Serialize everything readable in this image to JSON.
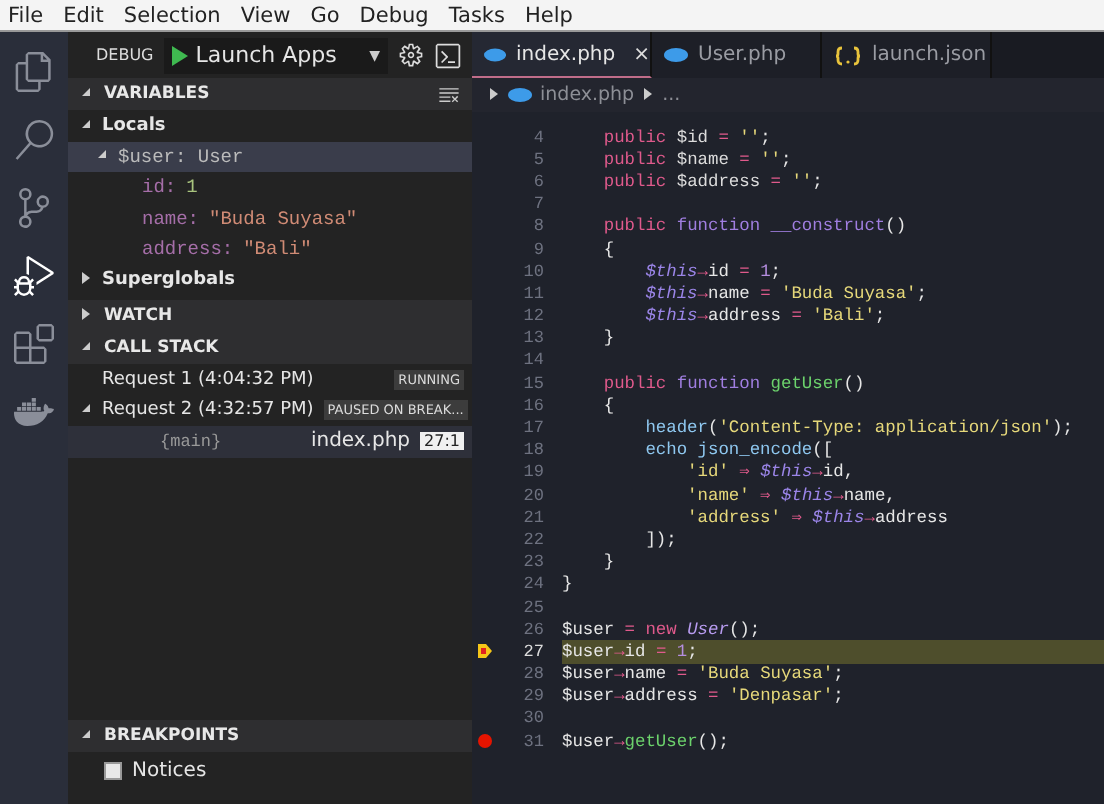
{
  "menu": [
    "File",
    "Edit",
    "Selection",
    "View",
    "Go",
    "Debug",
    "Tasks",
    "Help"
  ],
  "activity": [
    {
      "kind": "files",
      "selected": false
    },
    {
      "kind": "search",
      "selected": false
    },
    {
      "kind": "git",
      "selected": false
    },
    {
      "kind": "debug",
      "selected": true
    },
    {
      "kind": "extensions",
      "selected": false
    },
    {
      "kind": "docker",
      "selected": false
    }
  ],
  "debug_toolbar": {
    "label": "DEBUG",
    "config": "Launch Apps",
    "caret": "▼"
  },
  "sidebar": {
    "variables": {
      "title": "VARIABLES",
      "expanded": true,
      "scopes": [
        {
          "label": "Locals",
          "expanded": true,
          "children": [
            {
              "label": "$user: User",
              "expanded": true,
              "selected": true,
              "children": [
                {
                  "key": "id:",
                  "value": "1",
                  "kind": "number"
                },
                {
                  "key": "name:",
                  "value": "\"Buda Suyasa\"",
                  "kind": "string"
                },
                {
                  "key": "address:",
                  "value": "\"Bali\"",
                  "kind": "string"
                }
              ]
            }
          ]
        },
        {
          "label": "Superglobals",
          "expanded": false
        }
      ]
    },
    "watch": {
      "title": "WATCH",
      "expanded": false
    },
    "call_stack": {
      "title": "CALL STACK",
      "expanded": true,
      "requests": [
        {
          "label": "Request 1 (4:04:32 PM)",
          "status": "RUNNING",
          "expanded": false
        },
        {
          "label": "Request 2 (4:32:57 PM)",
          "status": "PAUSED ON BREAK...",
          "expanded": true,
          "frames": [
            {
              "name": "{main}",
              "file": "index.php",
              "position": "27:1"
            }
          ]
        }
      ]
    },
    "breakpoints": {
      "title": "BREAKPOINTS",
      "expanded": true,
      "items": [
        {
          "label": "Notices",
          "checked": false
        }
      ]
    }
  },
  "tabs": [
    {
      "label": "index.php",
      "kind": "php",
      "selected": true,
      "close": "×"
    },
    {
      "label": "User.php",
      "kind": "php",
      "selected": false
    },
    {
      "label": "launch.json",
      "kind": "json",
      "selected": false
    }
  ],
  "breadcrumb": {
    "file": "index.php",
    "rest": "..."
  },
  "code": [
    {
      "n": "4",
      "tokens": [
        {
          "kind": "keyword",
          "text": "    public"
        },
        {
          "kind": "variable",
          "text": " $id"
        },
        {
          "kind": "operator",
          "text": " = "
        },
        {
          "kind": "string",
          "text": "''"
        },
        {
          "kind": "plain",
          "text": ";"
        }
      ]
    },
    {
      "n": "5",
      "tokens": [
        {
          "kind": "keyword",
          "text": "    public"
        },
        {
          "kind": "variable",
          "text": " $name"
        },
        {
          "kind": "operator",
          "text": " = "
        },
        {
          "kind": "string",
          "text": "''"
        },
        {
          "kind": "plain",
          "text": ";"
        }
      ]
    },
    {
      "n": "6",
      "tokens": [
        {
          "kind": "keyword",
          "text": "    public"
        },
        {
          "kind": "variable",
          "text": " $address"
        },
        {
          "kind": "operator",
          "text": " = "
        },
        {
          "kind": "string",
          "text": "''"
        },
        {
          "kind": "plain",
          "text": ";"
        }
      ]
    },
    {
      "n": "7"
    },
    {
      "n": "8",
      "tokens": [
        {
          "kind": "keyword",
          "text": "    public"
        },
        {
          "kind": "function",
          "text": " function"
        },
        {
          "kind": "definition",
          "text": " __construct"
        },
        {
          "kind": "plain",
          "text": "()"
        }
      ]
    },
    {
      "n": "9",
      "tokens": [
        {
          "kind": "plain",
          "text": "    {"
        }
      ]
    },
    {
      "n": "10",
      "tokens": [
        {
          "kind": "this",
          "text": "        $this"
        },
        {
          "kind": "operator",
          "text": "→"
        },
        {
          "kind": "plain",
          "text": "id"
        },
        {
          "kind": "operator",
          "text": " = "
        },
        {
          "kind": "number",
          "text": "1"
        },
        {
          "kind": "plain",
          "text": ";"
        }
      ]
    },
    {
      "n": "11",
      "tokens": [
        {
          "kind": "this",
          "text": "        $this"
        },
        {
          "kind": "operator",
          "text": "→"
        },
        {
          "kind": "plain",
          "text": "name"
        },
        {
          "kind": "operator",
          "text": " = "
        },
        {
          "kind": "string",
          "text": "'Buda Suyasa'"
        },
        {
          "kind": "plain",
          "text": ";"
        }
      ]
    },
    {
      "n": "12",
      "tokens": [
        {
          "kind": "this",
          "text": "        $this"
        },
        {
          "kind": "operator",
          "text": "→"
        },
        {
          "kind": "plain",
          "text": "address"
        },
        {
          "kind": "operator",
          "text": " = "
        },
        {
          "kind": "string",
          "text": "'Bali'"
        },
        {
          "kind": "plain",
          "text": ";"
        }
      ]
    },
    {
      "n": "13",
      "tokens": [
        {
          "kind": "plain",
          "text": "    }"
        }
      ]
    },
    {
      "n": "14"
    },
    {
      "n": "15",
      "tokens": [
        {
          "kind": "keyword",
          "text": "    public"
        },
        {
          "kind": "function",
          "text": " function"
        },
        {
          "kind": "call",
          "text": " getUser"
        },
        {
          "kind": "plain",
          "text": "()"
        }
      ]
    },
    {
      "n": "16",
      "tokens": [
        {
          "kind": "plain",
          "text": "    {"
        }
      ]
    },
    {
      "n": "17",
      "tokens": [
        {
          "kind": "builtin",
          "text": "        header"
        },
        {
          "kind": "plain",
          "text": "("
        },
        {
          "kind": "string",
          "text": "'Content-Type: application/json'"
        },
        {
          "kind": "plain",
          "text": ");"
        }
      ]
    },
    {
      "n": "18",
      "tokens": [
        {
          "kind": "builtin",
          "text": "        echo json_encode"
        },
        {
          "kind": "plain",
          "text": "(["
        }
      ]
    },
    {
      "n": "19",
      "tokens": [
        {
          "kind": "string",
          "text": "            'id'"
        },
        {
          "kind": "operator",
          "text": " ⇒ "
        },
        {
          "kind": "this",
          "text": "$this"
        },
        {
          "kind": "operator",
          "text": "→"
        },
        {
          "kind": "plain",
          "text": "id,"
        }
      ]
    },
    {
      "n": "20",
      "tokens": [
        {
          "kind": "string",
          "text": "            'name'"
        },
        {
          "kind": "operator",
          "text": " ⇒ "
        },
        {
          "kind": "this",
          "text": "$this"
        },
        {
          "kind": "operator",
          "text": "→"
        },
        {
          "kind": "plain",
          "text": "name,"
        }
      ]
    },
    {
      "n": "21",
      "tokens": [
        {
          "kind": "string",
          "text": "            'address'"
        },
        {
          "kind": "operator",
          "text": " ⇒ "
        },
        {
          "kind": "this",
          "text": "$this"
        },
        {
          "kind": "operator",
          "text": "→"
        },
        {
          "kind": "plain",
          "text": "address"
        }
      ]
    },
    {
      "n": "22",
      "tokens": [
        {
          "kind": "plain",
          "text": "        ]);"
        }
      ]
    },
    {
      "n": "23",
      "tokens": [
        {
          "kind": "plain",
          "text": "    }"
        }
      ]
    },
    {
      "n": "24",
      "tokens": [
        {
          "kind": "plain",
          "text": "}"
        }
      ]
    },
    {
      "n": "25"
    },
    {
      "n": "26",
      "tokens": [
        {
          "kind": "plain",
          "text": "$user"
        },
        {
          "kind": "operator",
          "text": " = "
        },
        {
          "kind": "keyword",
          "text": "new"
        },
        {
          "kind": "class",
          "text": " User"
        },
        {
          "kind": "plain",
          "text": "();"
        }
      ]
    },
    {
      "n": "27",
      "kind": "current",
      "tokens": [
        {
          "kind": "plain",
          "text": "$user"
        },
        {
          "kind": "operator",
          "text": "→"
        },
        {
          "kind": "plain",
          "text": "id"
        },
        {
          "kind": "operator",
          "text": " = "
        },
        {
          "kind": "number",
          "text": "1"
        },
        {
          "kind": "plain",
          "text": ";"
        }
      ]
    },
    {
      "n": "28",
      "tokens": [
        {
          "kind": "plain",
          "text": "$user"
        },
        {
          "kind": "operator",
          "text": "→"
        },
        {
          "kind": "plain",
          "text": "name"
        },
        {
          "kind": "operator",
          "text": " = "
        },
        {
          "kind": "string",
          "text": "'Buda Suyasa'"
        },
        {
          "kind": "plain",
          "text": ";"
        }
      ]
    },
    {
      "n": "29",
      "tokens": [
        {
          "kind": "plain",
          "text": "$user"
        },
        {
          "kind": "operator",
          "text": "→"
        },
        {
          "kind": "plain",
          "text": "address"
        },
        {
          "kind": "operator",
          "text": " = "
        },
        {
          "kind": "string",
          "text": "'Denpasar'"
        },
        {
          "kind": "plain",
          "text": ";"
        }
      ]
    },
    {
      "n": "30"
    },
    {
      "n": "31",
      "kind": "breakpoint",
      "tokens": [
        {
          "kind": "plain",
          "text": "$user"
        },
        {
          "kind": "operator",
          "text": "→"
        },
        {
          "kind": "call",
          "text": "getUser"
        },
        {
          "kind": "plain",
          "text": "();"
        }
      ]
    }
  ]
}
